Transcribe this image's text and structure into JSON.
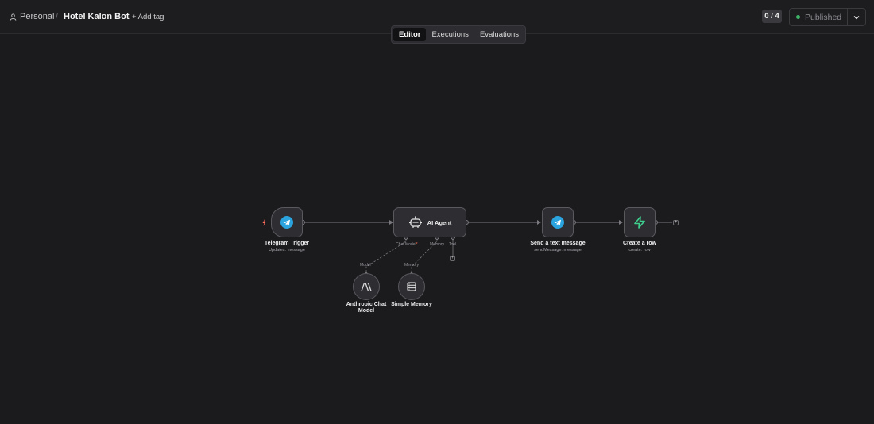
{
  "header": {
    "workspace": "Personal",
    "separator": "/",
    "workflow_title": "Hotel Kalon Bot",
    "add_tag": "+ Add tag",
    "counter": "0 / 4",
    "publish_label": "Published",
    "publish_status_color": "#3fb067"
  },
  "tabs": [
    {
      "label": "Editor",
      "active": true
    },
    {
      "label": "Executions",
      "active": false
    },
    {
      "label": "Evaluations",
      "active": false
    }
  ],
  "nodes": {
    "telegram_trigger": {
      "label": "Telegram Trigger",
      "sub": "Updates: message",
      "icon": "telegram-icon"
    },
    "ai_agent": {
      "label": "AI Agent",
      "icon": "robot-icon",
      "handles": {
        "chat_model": "Chat Model",
        "required_mark": "*",
        "memory": "Memory",
        "tool": "Tool"
      }
    },
    "send_message": {
      "label": "Send a text message",
      "sub": "sendMessage: message",
      "icon": "telegram-icon"
    },
    "create_row": {
      "label": "Create a row",
      "sub": "create: row",
      "icon": "supabase-icon",
      "accent": "#3ecf8e"
    },
    "anthropic": {
      "label": "Anthropic Chat Model",
      "handle": "Model",
      "icon": "anthropic-icon"
    },
    "memory": {
      "label": "Simple Memory",
      "handle": "Memory",
      "icon": "database-icon"
    }
  },
  "colors": {
    "canvas_bg": "#1b1a1d",
    "node_bg": "#2e2d31",
    "telegram": "#2aa3df",
    "trigger_mark": "#ff6d5a"
  }
}
